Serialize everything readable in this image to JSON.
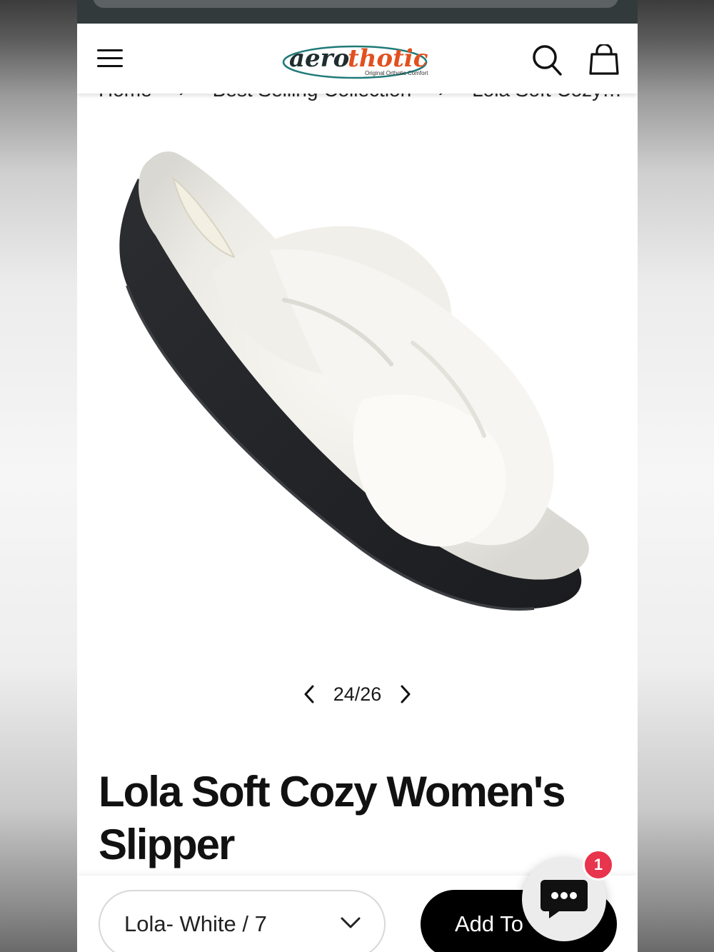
{
  "brand": {
    "name_part1": "aero",
    "name_part2": "thotic",
    "tagline": "Original Orthotic Comfort"
  },
  "breadcrumb": [
    "Home",
    "›",
    "Best Selling Collection",
    "›",
    "Lola Soft Cozy…"
  ],
  "gallery": {
    "current": "24/26"
  },
  "product": {
    "title": "Lola Soft Cozy Women's Slipper"
  },
  "purchase_bar": {
    "variant": "Lola- White / 7",
    "add_label": "Add To"
  },
  "chat": {
    "badge_count": "1"
  },
  "colors": {
    "brand_teal": "#1f7a78",
    "brand_orange": "#e2501f",
    "badge_red": "#e8344c"
  },
  "icons": [
    "menu-icon",
    "search-icon",
    "bag-icon",
    "chevron-left-icon",
    "chevron-right-icon",
    "chevron-down-icon",
    "chat-icon"
  ]
}
